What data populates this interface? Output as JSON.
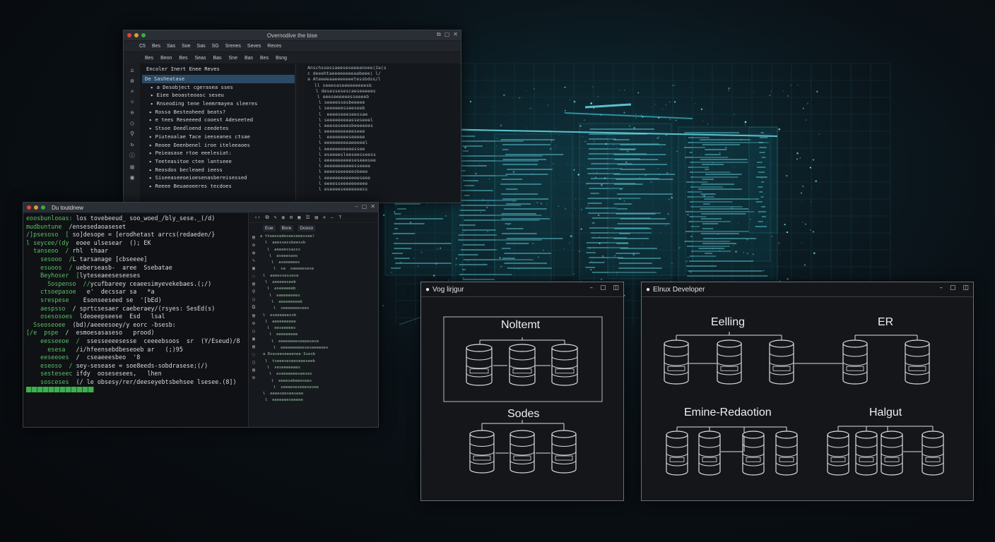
{
  "ide": {
    "title": "Overnodive the bise",
    "menu": [
      "C5",
      "Bes",
      "Sas",
      "Soe",
      "Sas",
      "SG",
      "Srenes",
      "Seves",
      "Reces"
    ],
    "toolbar": [
      "Bes",
      "Beon",
      "Bes",
      "Seas",
      "Bas",
      "Sne",
      "Bas",
      "Bes",
      "Bsng"
    ],
    "tree_header": "Encoler Inert Enee Reves",
    "tree_rows": [
      "De Sasheatase",
      "a Desobject cgerasea sses",
      "Eiee beoasteoasc seseu",
      "Rnseoding tene leemrmayea sleeres",
      "Rossa Besteoheed beats?",
      "e tees Reseeeed cooest Adeseeted",
      "Stsoe Deedloend ceedetes",
      "Piuteoalae Tace ieeseanes ctsae",
      "Reoee Deenbenel iroe iteleeaoes",
      "Peieasase rtoe eeelesiat:",
      "Teeteasitoe ctee lantseee",
      "Reosdos becleaed ieess",
      "Siseeaseeoeioesenasbereisessed",
      "Reeee Beuaeoeeres tecdoes"
    ],
    "code_lines": [
      "Anschsoassaeeseseeeanoee(2a(s",
      "c deeehtaeeeeeeeeaabeee( l/",
      "a Ateeeeaaeeeeeeetessbdss/l",
      "ll seeesaseeeeeeeeesb",
      "l desessesescaeseeeees",
      "l eeeseeeeeesseeeeb",
      "l seeeessesbeeeee",
      "l seeeeeesseeseeb",
      "l  eeeeseeeseessae",
      "l seeeeeeeeasseseeel",
      "l eeeseseeesbeeeeees",
      "l eeeeeeeeeeeseee",
      "l  eeeeeeeeseeeee",
      "l eeeeeeeeeaeeeeel",
      "l eeeeeeeeeeessee",
      "l eseeeesleeseesseess",
      "l eeeeeeeeeeseseeesee",
      "l eeeeeeeeeeesseeee",
      "l eeeeseeeeeesbeee",
      "l eeeeeeeeeeeeeseee",
      "l eeeesseeeeeeeeee",
      "l eseeeeseeeeeeess"
    ]
  },
  "terminal": {
    "title": "Du toutdnew",
    "lines": [
      {
        "p": "eoosbunlooas:",
        "t": " los tovebeeud_ soo_woed_/bly_sese._(/d)"
      },
      {
        "p": "mudbuntune",
        "t": "  /ensesedaoaseset"
      },
      {
        "p": "/]psesoso  [ ",
        "t": "so]desope = [erodhetast arrcs(redaeden/}"
      },
      {
        "p": "l seycee/(dy",
        "t": "  eoee ulsesear  (); EK"
      },
      {
        "p": "  tanseoo  / ",
        "t": "rhl  thaar"
      },
      {
        "p": "    sesooo  /",
        "t": "L tarsanage [cbseeee]"
      },
      {
        "p": "    esuoos  / ",
        "t": "ueberseasb-  aree  Ssebatae"
      },
      {
        "p": "    Beyhoser  [",
        "t": "lyteseaeeseseeses"
      },
      {
        "p": "      Sospenso  //",
        "t": "ycufbareey ceaeesimyevekebaes.(;/)"
      },
      {
        "p": "    ctsoepasoe",
        "t": "   e'  decssar sa   *a"
      },
      {
        "p": "    srespese    ",
        "t": "Esonseeseed se  '[bEd)"
      },
      {
        "p": "    aespsso  ",
        "t": "/ sprtcsesaer caeberaey/(rsyes: SesEd(s)"
      },
      {
        "p": "    osesosoes  ",
        "t": "ldeoeepseese  Esd   lsal"
      },
      {
        "p": "  Sseoseoee  ",
        "t": "(bd)/aeeeesoey/y eorc -bsesb:"
      },
      {
        "p": "[/e  pspe  ",
        "t": "/  esmoesasaseso   prood)"
      },
      {
        "p": "    eesseeoe  /  ",
        "t": "ssesseeeesesse  ceeeebsoos  sr  (Y/Eseud)/8"
      },
      {
        "p": "      esesa   ",
        "t": "/i/hfeensebdbeseoeb ar   (;)95"
      },
      {
        "p": "    eeseeoes  ",
        "t": "/  cseaeeesbeo  '8"
      },
      {
        "p": "    eseoso  /",
        "t": " sey-sesease = soe8eeds-sobdrasese;(/)"
      },
      {
        "p": "    sesteseec",
        "t": " ifdy  oosesesees,   lhen"
      },
      {
        "p": "    sosceses  ",
        "t": "(/ le obsesy/rer/deeseyebtsbehsee lsesee.(8])"
      }
    ],
    "tool_tabs": [
      "Eoe",
      "Bore",
      "Dooso"
    ],
    "tool_lines": [
      "a tteeesedeseeseeessee!",
      "l  aeessessbeessb",
      "l  aeeeessasss",
      "l  aseeesaoo",
      "l  aseeeeees",
      "l  sa  seeeeesese",
      "l  aeeessessese",
      "l  aeeeeeseeb",
      "l  aseeeeeeb",
      "l  eaeeeeeees",
      "l  aeeeeeeeeb",
      "l  seeeeeeesees",
      "l  eseeeeeessb",
      "l  aeeeeeeeee",
      "l  eeseeeees",
      "l  eeeeeeeee",
      "l  eeeeeeeeseeeesese",
      "l  eeeeeeeeeeseseeeeees",
      "a Dseseeseeeenee Ssesb",
      "l  tseeeseseeseeeseeb",
      "l  seseeeeeaes",
      "l  eseeeeeeeseeses",
      "l  eeeesebeeesees",
      "l  seeeeseseeesesee",
      "l  eeeeseeseeseee",
      "l  eeeeeeeseeeee"
    ]
  },
  "db_left": {
    "title": "Vog lirjgur",
    "label_top": "Noltemt",
    "label_bottom": "Sodes",
    "box_tag": "CHMAB",
    "ctrl": [
      "–",
      "▢",
      "◫"
    ]
  },
  "db_right": {
    "title": "Elnux Developer",
    "labels": [
      "Eelling",
      "ER",
      "Emine-Redaotion",
      "Halgut"
    ],
    "box_tag": "CHMAB",
    "ctrl": [
      "–",
      "▢",
      "◫"
    ]
  },
  "colors": {
    "accent": "#3fd6e6",
    "term_green": "#5ec06a",
    "select": "#2b4a66"
  }
}
